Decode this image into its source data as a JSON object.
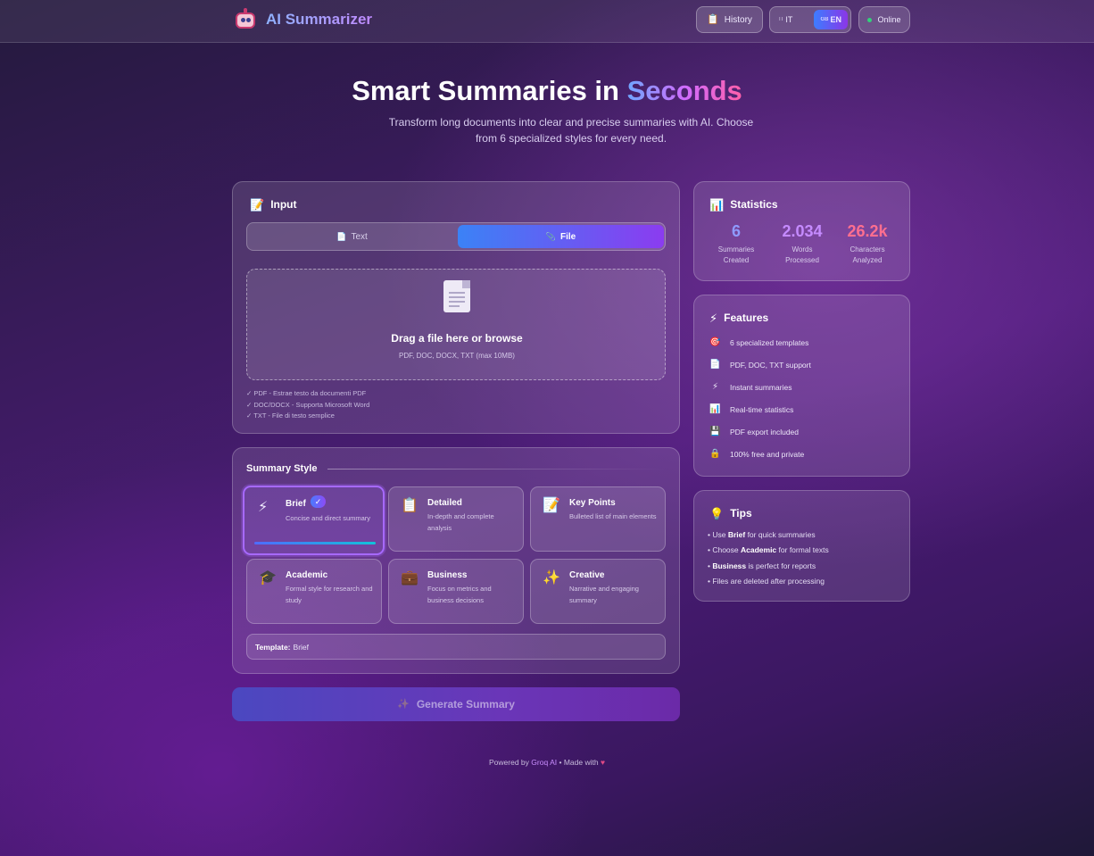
{
  "header": {
    "brand": "AI Summarizer",
    "history_label": "History",
    "langs": [
      {
        "flag": "IT",
        "code": "IT",
        "active": false
      },
      {
        "flag": "GB",
        "code": "EN",
        "active": true
      }
    ],
    "status_label": "Online",
    "colors": {
      "status_dot": "#33d17a",
      "accent_from": "#3b82f6",
      "accent_to": "#8b3cf0"
    }
  },
  "hero": {
    "title_main": "Smart Summaries in ",
    "title_accent": "Seconds",
    "subtitle": "Transform long documents into clear and precise summaries with AI. Choose from 6 specialized styles for every need."
  },
  "input": {
    "title": "Input",
    "tabs": [
      {
        "label": "Text",
        "icon": "document-icon",
        "active": false
      },
      {
        "label": "File",
        "icon": "paperclip-icon",
        "active": true
      }
    ],
    "dropzone_title": "Drag a file here or browse",
    "dropzone_sub": "PDF, DOC, DOCX, TXT (max 10MB)",
    "support": [
      "✓ PDF - Estrae testo da documenti PDF",
      "✓ DOC/DOCX - Supporta Microsoft Word",
      "✓ TXT - File di testo semplice"
    ]
  },
  "summary_style": {
    "title": "Summary Style",
    "options": [
      {
        "name": "Brief",
        "desc": "Concise and direct summary",
        "icon": "lightning-icon",
        "selected": true
      },
      {
        "name": "Detailed",
        "desc": "In-depth and complete analysis",
        "icon": "clipboard-icon",
        "selected": false
      },
      {
        "name": "Key Points",
        "desc": "Bulleted list of main elements",
        "icon": "memo-icon",
        "selected": false
      },
      {
        "name": "Academic",
        "desc": "Formal style for research and study",
        "icon": "graduation-cap-icon",
        "selected": false
      },
      {
        "name": "Business",
        "desc": "Focus on metrics and business decisions",
        "icon": "briefcase-icon",
        "selected": false
      },
      {
        "name": "Creative",
        "desc": "Narrative and engaging summary",
        "icon": "sparkles-icon",
        "selected": false
      }
    ],
    "template_label": "Template:",
    "template_value": "Brief"
  },
  "generate_label": "Generate Summary",
  "footer": {
    "powered": "Powered by",
    "groq": "Groq AI",
    "made": "• Made with"
  },
  "statistics": {
    "title": "Statistics",
    "items": [
      {
        "value": "6",
        "label": "Summaries Created",
        "color": "#8f9bff"
      },
      {
        "value": "2.034",
        "label": "Words Processed",
        "color": "#c58bff"
      },
      {
        "value": "26.2k",
        "label": "Characters Analyzed",
        "color": "#ff6f8f"
      }
    ]
  },
  "features": {
    "title": "Features",
    "items": [
      {
        "icon": "target-icon",
        "label": "6 specialized templates"
      },
      {
        "icon": "document-icon",
        "label": "PDF, DOC, TXT support"
      },
      {
        "icon": "lightning-icon",
        "label": "Instant summaries"
      },
      {
        "icon": "bar-chart-icon",
        "label": "Real-time statistics"
      },
      {
        "icon": "floppy-disk-icon",
        "label": "PDF export included"
      },
      {
        "icon": "lock-icon",
        "label": "100% free and private"
      }
    ]
  },
  "tips": {
    "title": "Tips",
    "items": [
      {
        "pre": "• Use ",
        "bold": "Brief",
        "post": " for quick summaries"
      },
      {
        "pre": "• Choose ",
        "bold": "Academic",
        "post": " for formal texts"
      },
      {
        "pre": "• ",
        "bold": "Business",
        "post": " is perfect for reports"
      },
      {
        "pre": "• Files are deleted after processing",
        "bold": "",
        "post": ""
      }
    ]
  }
}
